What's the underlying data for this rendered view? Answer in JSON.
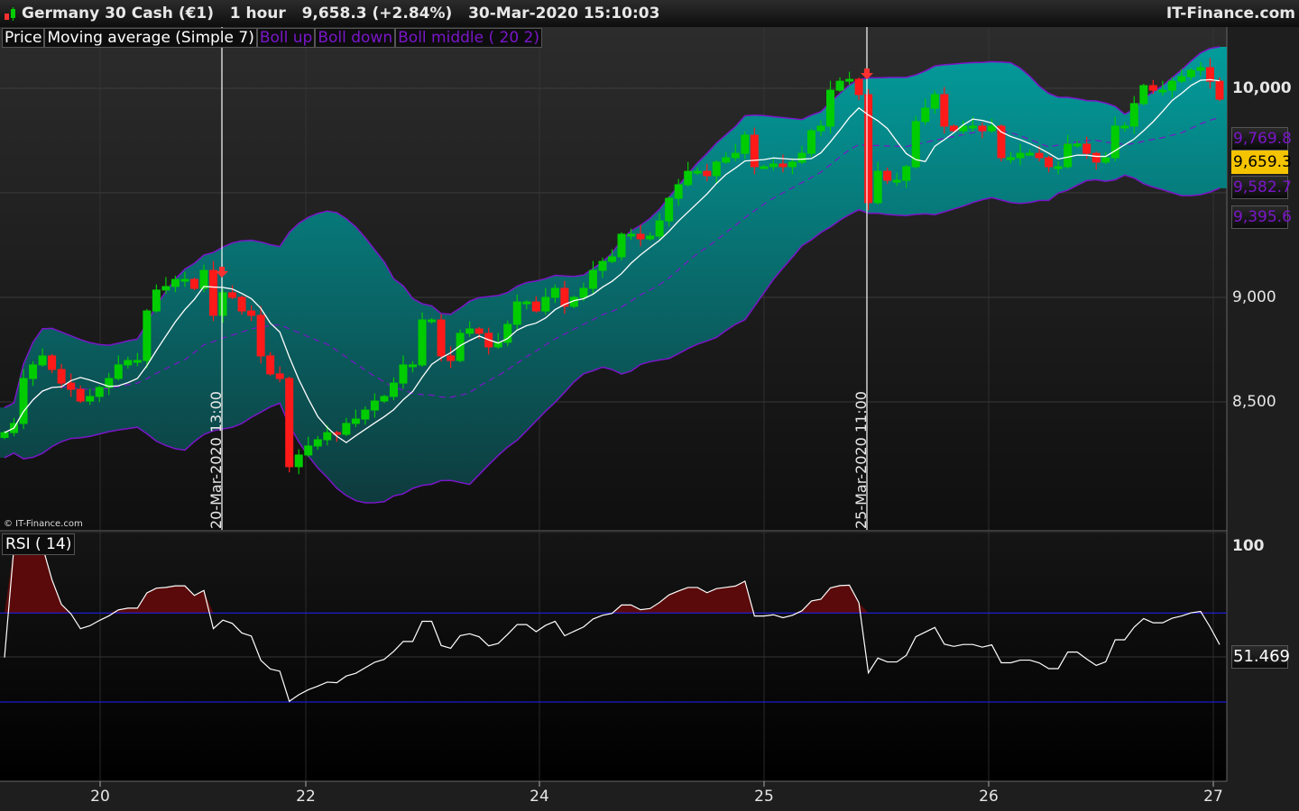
{
  "header": {
    "instrument": "Germany 30 Cash (€1)",
    "timeframe": "1 hour",
    "price": "9,658.3 (+2.84%)",
    "datetime": "30-Mar-2020 15:10:03",
    "brand": "IT-Finance.com",
    "copyright": "© IT-Finance.com"
  },
  "legend": {
    "price": "Price",
    "ma": "Moving average (Simple 7)",
    "boll_up": "Boll up",
    "boll_down": "Boll down",
    "boll_middle": "Boll middle ( 20 2)"
  },
  "price_axis": {
    "ticks": [
      "10,000",
      "9,000",
      "8,500"
    ],
    "labels": {
      "boll_up": "9,769.8",
      "last": "9,659.3",
      "boll_middle": "9,582.7",
      "boll_down": "9,395.6"
    }
  },
  "rsi": {
    "title": "RSI ( 14)",
    "axis_top": "100",
    "last": "51.469",
    "overbought": 70,
    "oversold": 30
  },
  "markers": [
    "20-Mar-2020 13:00",
    "25-Mar-2020 11:00"
  ],
  "x_axis": [
    "20",
    "22",
    "24",
    "25",
    "26",
    "27"
  ],
  "colors": {
    "up": "#00cc00",
    "down": "#ff1a1a",
    "band": "#0a9a9a",
    "boll_line": "#7a16c8",
    "ma": "#ffffff",
    "rsi_level": "#2020ff",
    "last_price_bg": "#f5c400"
  },
  "chart_data": {
    "type": "candlestick",
    "title": "Germany 30 Cash (€1) 1 hour",
    "ylim": [
      7890,
      10290
    ],
    "indicators": [
      "SMA 7",
      "Bollinger 20 2",
      "RSI 14"
    ],
    "closes": [
      8353,
      8397,
      8612,
      8677,
      8720,
      8655,
      8590,
      8560,
      8504,
      8526,
      8569,
      8612,
      8677,
      8698,
      8698,
      8935,
      9035,
      9052,
      9086,
      9086,
      9043,
      9129,
      8914,
      9022,
      9000,
      8935,
      8914,
      8720,
      8634,
      8612,
      8190,
      8246,
      8289,
      8319,
      8353,
      8345,
      8397,
      8418,
      8461,
      8504,
      8526,
      8590,
      8677,
      8677,
      8892,
      8892,
      8720,
      8698,
      8828,
      8849,
      8828,
      8763,
      8785,
      8871,
      8978,
      8978,
      8935,
      9000,
      9043,
      8957,
      9000,
      9043,
      9129,
      9172,
      9194,
      9302,
      9302,
      9280,
      9293,
      9366,
      9474,
      9539,
      9603,
      9603,
      9582,
      9647,
      9668,
      9689,
      9776,
      9625,
      9625,
      9638,
      9625,
      9647,
      9689,
      9797,
      9819,
      9991,
      10034,
      10043,
      9970,
      9453,
      9603,
      9560,
      9560,
      9625,
      9841,
      9905,
      9970,
      9819,
      9797,
      9819,
      9819,
      9797,
      9819,
      9668,
      9668,
      9689,
      9689,
      9668,
      9625,
      9625,
      9733,
      9733,
      9689,
      9647,
      9668,
      9819,
      9819,
      9927,
      10013,
      9991,
      9991,
      10034,
      10056,
      10086,
      10099,
      10034,
      9948
    ]
  }
}
